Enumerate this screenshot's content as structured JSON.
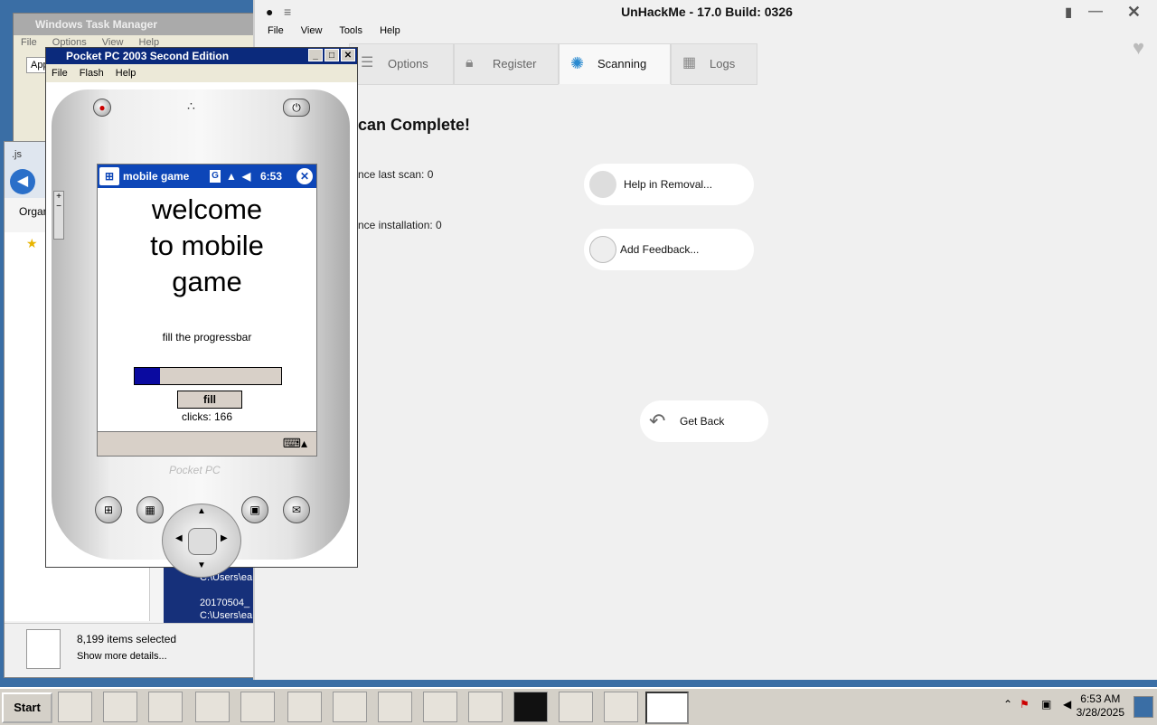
{
  "task_manager": {
    "title": "Windows Task Manager",
    "menu": [
      "File",
      "Options",
      "View",
      "Help"
    ],
    "tab_partial": "App"
  },
  "explorer": {
    "title_partial": ".js",
    "organize_partial": "Organ",
    "files": [
      {
        "name": "",
        "path": "C:\\Users\\ea"
      },
      {
        "name": "20170504_",
        "path": "C:\\Users\\ea"
      }
    ],
    "status": {
      "selected": "8,199 items selected",
      "details": "Show more details..."
    }
  },
  "unhackme": {
    "title": "UnHackMe - 17.0 Build: 0326",
    "menu": [
      "File",
      "View",
      "Tools",
      "Help"
    ],
    "tabs": [
      {
        "label": "Options",
        "icon": "options-icon"
      },
      {
        "label": "Register",
        "icon": "lock-icon"
      },
      {
        "label": "Scanning",
        "icon": "spinner-icon",
        "active": true
      },
      {
        "label": "Logs",
        "icon": "logs-icon"
      }
    ],
    "heading": "can Complete!",
    "stat1": "nce last scan: 0",
    "stat2": "nce installation: 0",
    "help_btn": "Help in Removal...",
    "feedback_btn": "Add Feedback...",
    "get_back": "Get Back"
  },
  "pocketpc": {
    "title": "Pocket PC 2003 Second Edition",
    "menu": [
      "File",
      "Flash",
      "Help"
    ],
    "app_title": "mobile game",
    "status_g": "G",
    "time": "6:53",
    "welcome": [
      "welcome",
      "to mobile",
      "game"
    ],
    "instruction": "fill the progressbar",
    "progress": 0.17,
    "fill_button": "fill",
    "clicks": "clicks: 166",
    "brand": "Pocket PC"
  },
  "taskbar": {
    "start": "Start",
    "time": "6:53 AM",
    "date": "3/28/2025"
  }
}
